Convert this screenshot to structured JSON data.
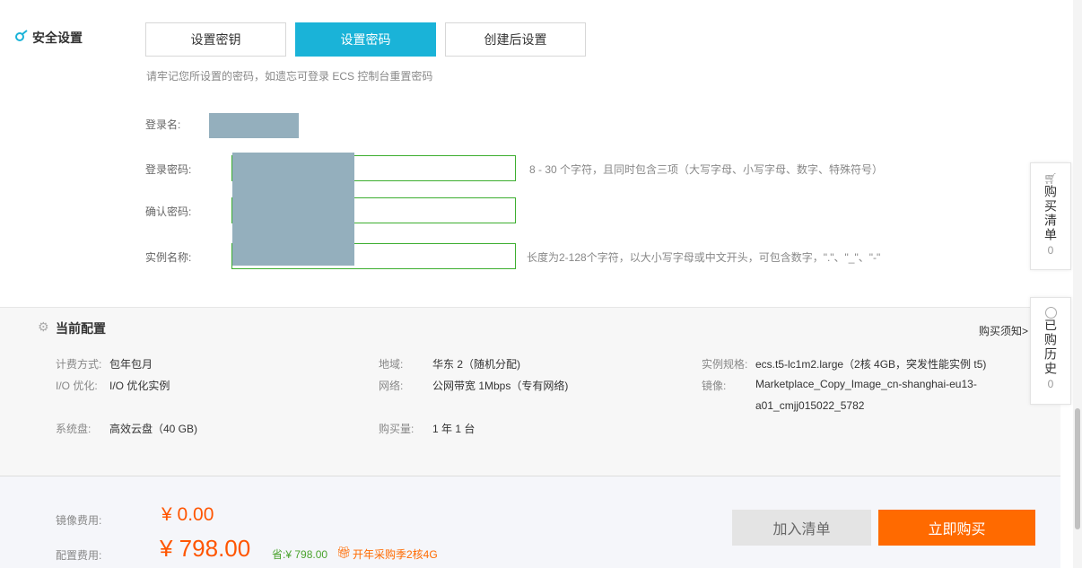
{
  "security": {
    "title": "安全设置",
    "tabs": [
      "设置密钥",
      "设置密码",
      "创建后设置"
    ],
    "hint": "请牢记您所设置的密码，如遗忘可登录 ECS 控制台重置密码",
    "login_name_label": "登录名:",
    "password_label": "登录密码:",
    "confirm_label": "确认密码:",
    "instance_name_label": "实例名称:",
    "password_hint": "8 - 30 个字符，且同时包含三项（大写字母、小写字母、数字、特殊符号）",
    "instance_hint": "长度为2-128个字符，以大小写字母或中文开头，可包含数字，\".\"、\"_\"、\"-\""
  },
  "config": {
    "title": "当前配置",
    "notice_link": "购买须知>",
    "items": [
      {
        "k": "计费方式:",
        "v": "包年包月"
      },
      {
        "k": "I/O 优化:",
        "v": "I/O 优化实例"
      },
      {
        "k": "系统盘:",
        "v": "高效云盘（40 GB)"
      },
      {
        "k": "地域:",
        "v": "华东 2（随机分配)"
      },
      {
        "k": "网络:",
        "v": "公网带宽 1Mbps（专有网络)"
      },
      {
        "k": "购买量:",
        "v": "1 年 1 台"
      },
      {
        "k": "实例规格:",
        "v": "ecs.t5-lc1m2.large（2核 4GB，突发性能实例 t5)"
      },
      {
        "k": "镜像:",
        "v": "Marketplace_Copy_Image_cn-shanghai-eu13-"
      },
      {
        "k": "",
        "v": "a01_cmjj015022_5782"
      }
    ]
  },
  "pricing": {
    "image_label": "镜像费用:",
    "image_price": "¥ 0.00",
    "config_label": "配置费用:",
    "config_price": "¥ 798.00",
    "save": "省:¥ 798.00",
    "promo": "开年采购季2核4G",
    "add_cart": "加入清单",
    "buy_now": "立即购买"
  },
  "sidebar": {
    "cart_label": "购买清单",
    "cart_count": "0",
    "history_label": "已购历史",
    "history_count": "0"
  },
  "colors": {
    "accent": "#1ab3d8",
    "price": "#ff5500",
    "buy": "#ff6a00",
    "save": "#4aa32e"
  }
}
